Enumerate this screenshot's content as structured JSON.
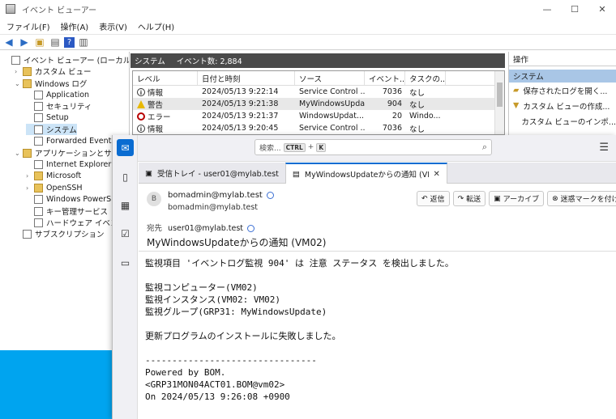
{
  "event_viewer": {
    "title": "イベント ビューアー",
    "menu": [
      "ファイル(F)",
      "操作(A)",
      "表示(V)",
      "ヘルプ(H)"
    ],
    "tree": [
      {
        "label": "イベント ビューアー (ローカル)",
        "indent": 0,
        "arrow": "",
        "icon": "app"
      },
      {
        "label": "カスタム ビュー",
        "indent": 1,
        "arrow": "›",
        "icon": "folder"
      },
      {
        "label": "Windows ログ",
        "indent": 1,
        "arrow": "⌄",
        "icon": "folder"
      },
      {
        "label": "Application",
        "indent": 2,
        "arrow": "",
        "icon": "log"
      },
      {
        "label": "セキュリティ",
        "indent": 2,
        "arrow": "",
        "icon": "log"
      },
      {
        "label": "Setup",
        "indent": 2,
        "arrow": "",
        "icon": "log"
      },
      {
        "label": "システム",
        "indent": 2,
        "arrow": "",
        "icon": "log",
        "selected": true
      },
      {
        "label": "Forwarded Events",
        "indent": 2,
        "arrow": "",
        "icon": "log"
      },
      {
        "label": "アプリケーションとサービス ロ",
        "indent": 1,
        "arrow": "⌄",
        "icon": "folder"
      },
      {
        "label": "Internet Explorer",
        "indent": 2,
        "arrow": "",
        "icon": "log"
      },
      {
        "label": "Microsoft",
        "indent": 2,
        "arrow": "›",
        "icon": "folder"
      },
      {
        "label": "OpenSSH",
        "indent": 2,
        "arrow": "›",
        "icon": "folder"
      },
      {
        "label": "Windows PowerShel",
        "indent": 2,
        "arrow": "",
        "icon": "log"
      },
      {
        "label": "キー管理サービス",
        "indent": 2,
        "arrow": "",
        "icon": "log"
      },
      {
        "label": "ハードウェア イベント",
        "indent": 2,
        "arrow": "",
        "icon": "log"
      },
      {
        "label": "サブスクリプション",
        "indent": 1,
        "arrow": "",
        "icon": "log"
      }
    ],
    "center_header": {
      "name": "システム",
      "count": "イベント数: 2,884"
    },
    "columns": [
      "レベル",
      "日付と時刻",
      "ソース",
      "イベント...",
      "タスクの..."
    ],
    "rows": [
      {
        "level": "情報",
        "level_type": "info",
        "datetime": "2024/05/13 9:22:14",
        "source": "Service Control ...",
        "event_id": "7036",
        "task": "なし"
      },
      {
        "level": "警告",
        "level_type": "warn",
        "datetime": "2024/05/13 9:21:38",
        "source": "MyWindowsUpda...",
        "event_id": "904",
        "task": "なし",
        "selected": true
      },
      {
        "level": "エラー",
        "level_type": "err",
        "datetime": "2024/05/13 9:21:37",
        "source": "WindowsUpdat...",
        "event_id": "20",
        "task": "Windo..."
      },
      {
        "level": "情報",
        "level_type": "info",
        "datetime": "2024/05/13 9:20:45",
        "source": "Service Control ...",
        "event_id": "7036",
        "task": "なし"
      }
    ],
    "actions": {
      "header": "操作",
      "section": "システム",
      "items": [
        "保存されたログを開く...",
        "カスタム ビューの作成...",
        "カスタム ビューのインポ..."
      ]
    }
  },
  "thunderbird": {
    "search": {
      "placeholder": "検索...",
      "key1": "CTRL",
      "plus": "+",
      "key2": "K"
    },
    "tabs": [
      {
        "label": "受信トレイ - user01@mylab.test",
        "active": false
      },
      {
        "label": "MyWindowsUpdateからの通知 (VM0",
        "active": true
      }
    ],
    "message": {
      "avatar_letter": "B",
      "from_name": "bomadmin@mylab.test",
      "from_addr": "bomadmin@mylab.test",
      "buttons": [
        "返信",
        "転送",
        "アーカイブ",
        "迷惑マークを付ける"
      ],
      "to_label": "宛先",
      "to": "user01@mylab.test",
      "subject": "MyWindowsUpdateからの通知 (VM02)",
      "body": "監視項目 'イベントログ監視 904' は 注意 ステータス を検出しました。\n\n監視コンピューター(VM02)\n監視インスタンス(VM02: VM02)\n監視グループ(GRP31: MyWindowsUpdate)\n\n更新プログラムのインストールに失敗しました。\n\n--------------------------------\nPowered by BOM.\n<GRP31MON04ACT01.BOM@vm02>\nOn 2024/05/13 9:26:08 +0900"
    }
  }
}
